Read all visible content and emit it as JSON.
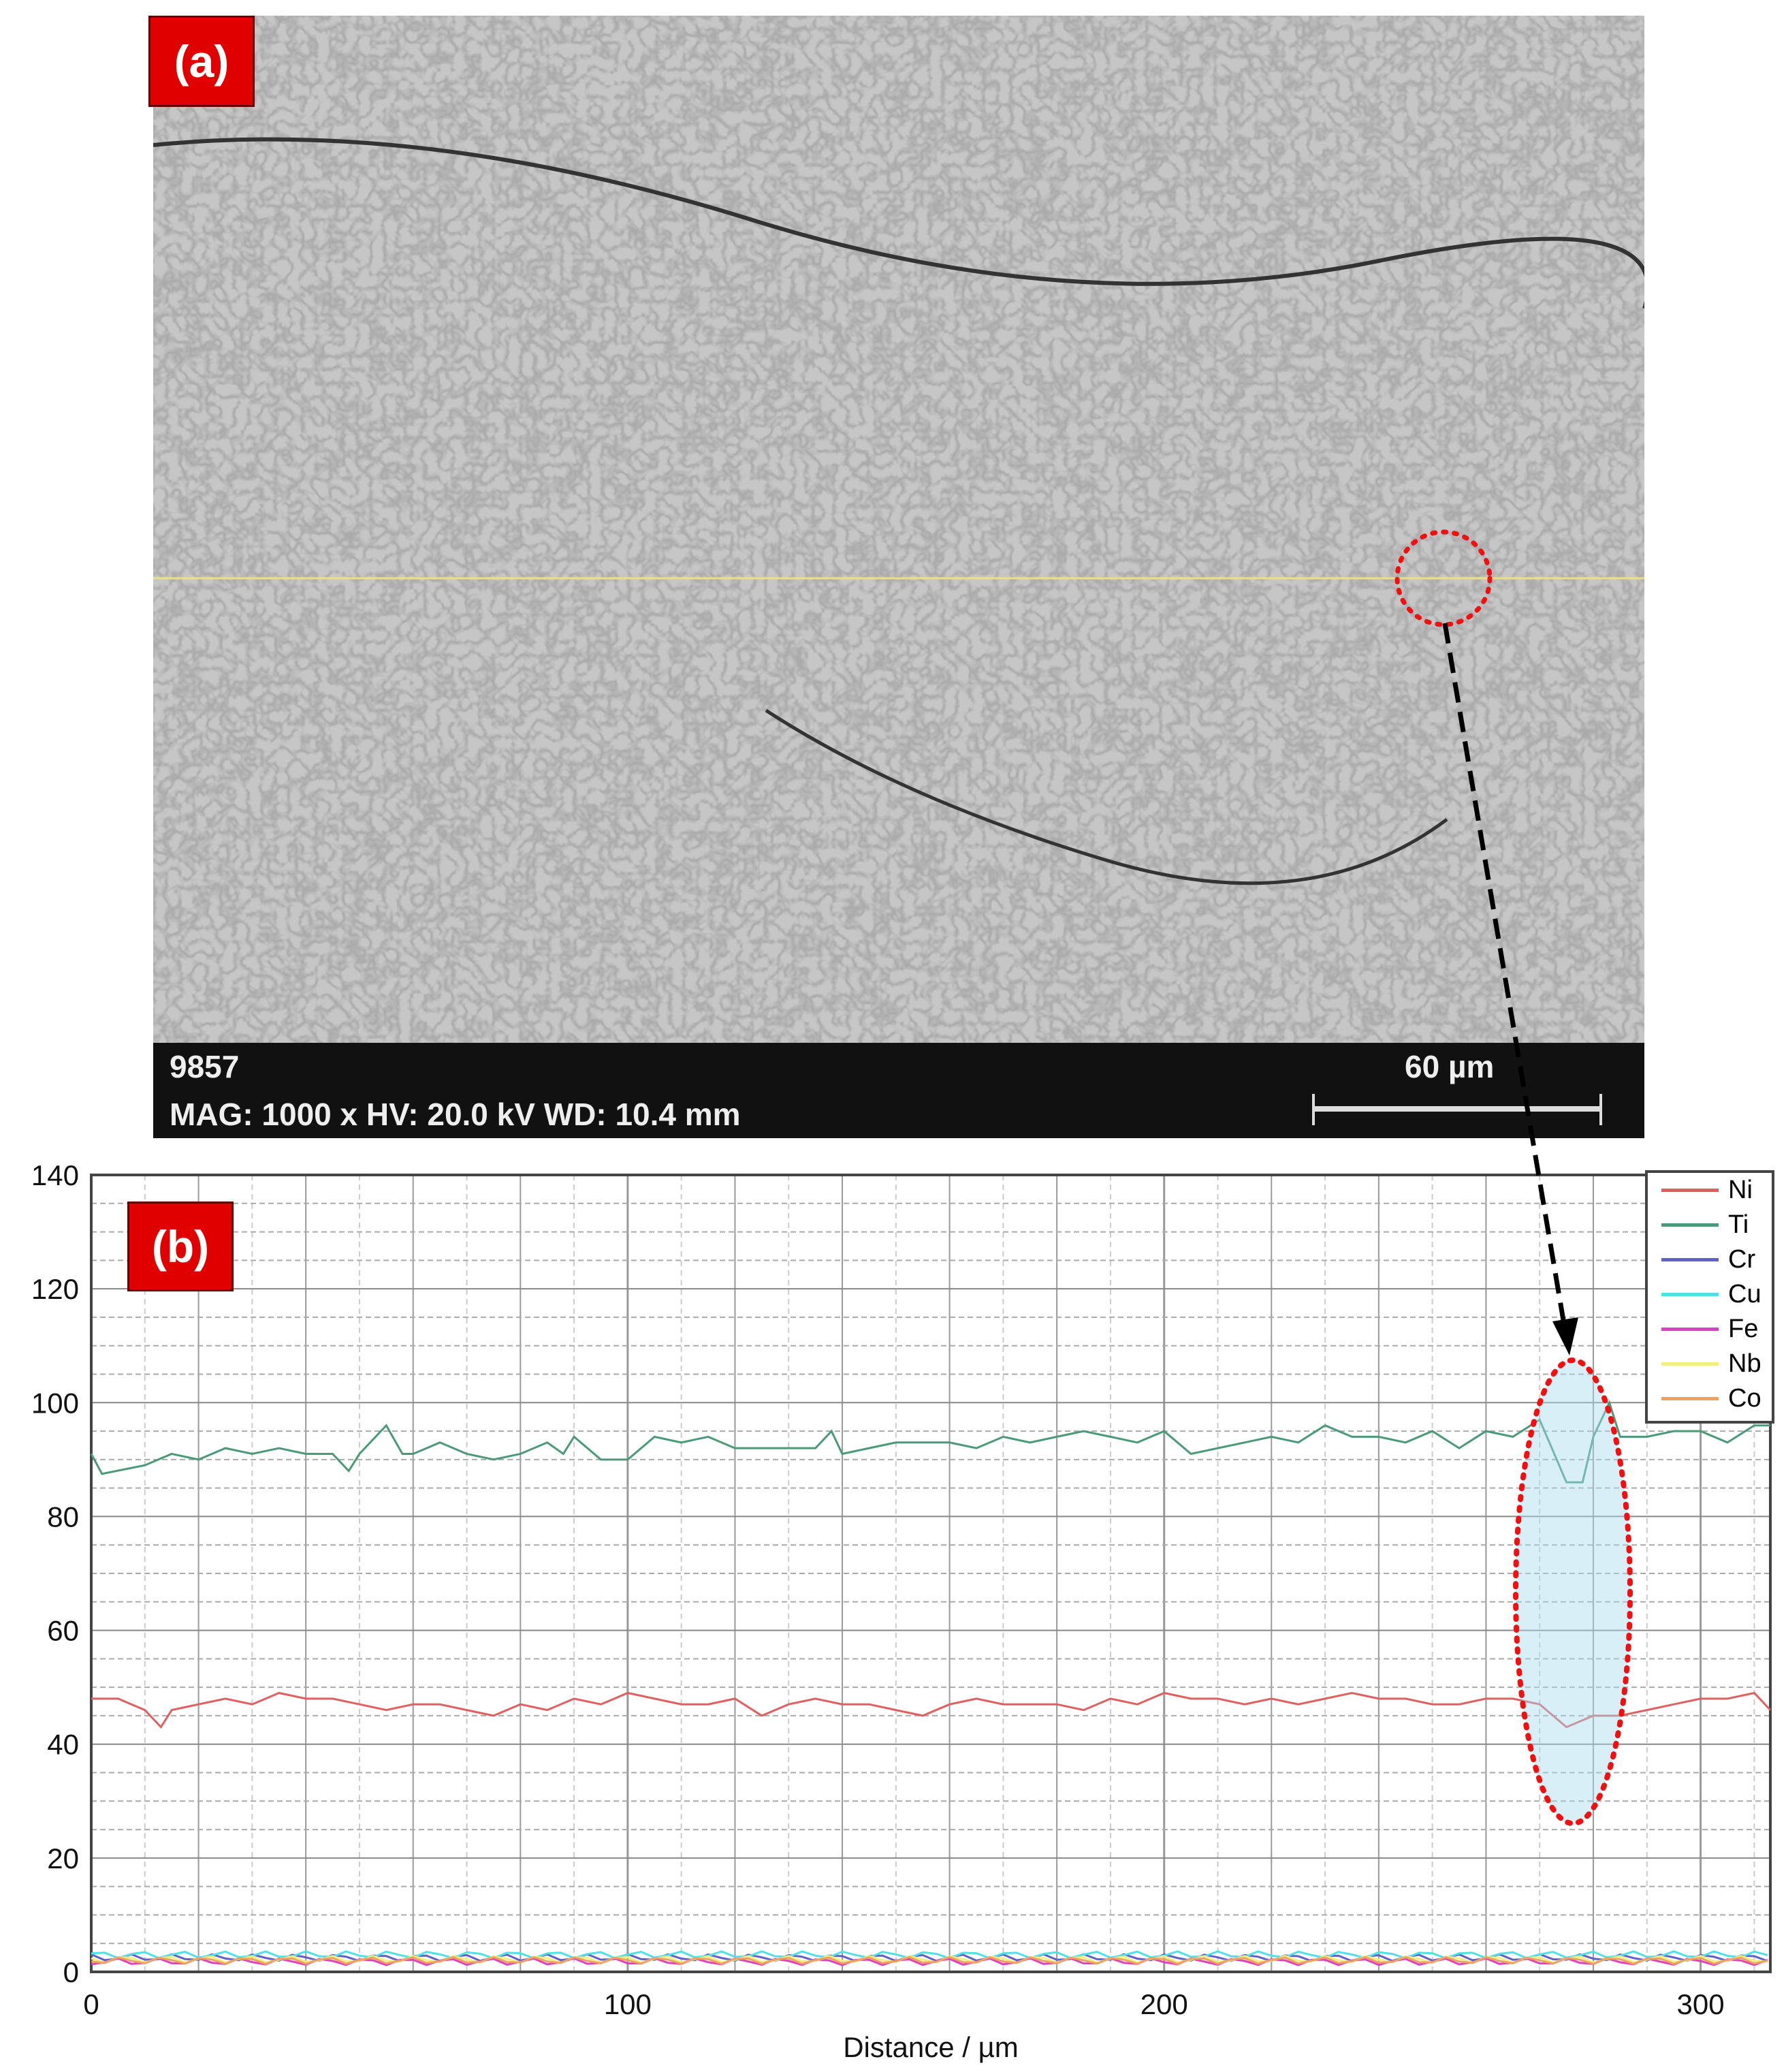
{
  "panel_a": {
    "label": "(a)",
    "image_id": "9857",
    "info": "MAG: 1000 x HV: 20.0 kV WD: 10.4 mm",
    "scale_label": "60 µm"
  },
  "panel_b": {
    "label": "(b)"
  },
  "chart_data": {
    "type": "line",
    "title": "",
    "xlabel": "Distance / µm",
    "ylabel": "",
    "xlim": [
      0,
      313
    ],
    "ylim": [
      0,
      140
    ],
    "xticks": [
      0,
      100,
      200,
      300
    ],
    "yticks": [
      0,
      20,
      40,
      60,
      80,
      100,
      120,
      140
    ],
    "grid": true,
    "legend_position": "top-right",
    "series": [
      {
        "name": "Ni",
        "color": "#e06060",
        "x": [
          0,
          5,
          10,
          13,
          15,
          20,
          25,
          30,
          35,
          40,
          45,
          50,
          55,
          60,
          65,
          70,
          75,
          80,
          85,
          90,
          95,
          100,
          105,
          110,
          115,
          120,
          125,
          130,
          135,
          140,
          145,
          150,
          155,
          160,
          165,
          170,
          175,
          180,
          185,
          190,
          195,
          200,
          205,
          210,
          215,
          220,
          225,
          230,
          235,
          240,
          245,
          250,
          255,
          260,
          265,
          270,
          275,
          280,
          285,
          290,
          295,
          300,
          305,
          310,
          313
        ],
        "y": [
          48,
          48,
          46,
          43,
          46,
          47,
          48,
          47,
          49,
          48,
          48,
          47,
          46,
          47,
          47,
          46,
          45,
          47,
          46,
          48,
          47,
          49,
          48,
          47,
          47,
          48,
          45,
          47,
          48,
          47,
          47,
          46,
          45,
          47,
          48,
          47,
          47,
          47,
          46,
          48,
          47,
          49,
          48,
          48,
          47,
          48,
          47,
          48,
          49,
          48,
          48,
          47,
          47,
          48,
          48,
          47,
          43,
          45,
          45,
          46,
          47,
          48,
          48,
          49,
          46
        ]
      },
      {
        "name": "Ti",
        "color": "#4a9a78",
        "x": [
          0,
          2,
          10,
          15,
          20,
          25,
          30,
          35,
          40,
          45,
          48,
          50,
          55,
          58,
          60,
          65,
          70,
          75,
          80,
          85,
          88,
          90,
          95,
          100,
          105,
          110,
          115,
          120,
          125,
          130,
          135,
          138,
          140,
          145,
          150,
          155,
          160,
          165,
          170,
          175,
          180,
          185,
          190,
          195,
          200,
          205,
          210,
          215,
          220,
          225,
          230,
          235,
          240,
          245,
          250,
          255,
          260,
          265,
          270,
          275,
          278,
          280,
          283,
          285,
          290,
          295,
          300,
          305,
          310,
          313
        ],
        "y": [
          91,
          87.5,
          89,
          91,
          90,
          92,
          91,
          92,
          91,
          91,
          88,
          91,
          96,
          91,
          91,
          93,
          91,
          90,
          91,
          93,
          91,
          94,
          90,
          90,
          94,
          93,
          94,
          92,
          92,
          92,
          92,
          95,
          91,
          92,
          93,
          93,
          93,
          92,
          94,
          93,
          94,
          95,
          94,
          93,
          95,
          91,
          92,
          93,
          94,
          93,
          96,
          94,
          94,
          93,
          95,
          92,
          95,
          94,
          97,
          86,
          86,
          94,
          100,
          94,
          94,
          95,
          95,
          93,
          96,
          96
        ]
      },
      {
        "name": "Cr",
        "color": "#6060c8",
        "x": [
          0,
          313
        ],
        "y": [
          2.5,
          2.5
        ]
      },
      {
        "name": "Cu",
        "color": "#50e0e8",
        "x": [
          0,
          313
        ],
        "y": [
          3,
          3
        ]
      },
      {
        "name": "Fe",
        "color": "#e040c0",
        "x": [
          0,
          313
        ],
        "y": [
          1.8,
          1.8
        ]
      },
      {
        "name": "Nb",
        "color": "#f0f080",
        "x": [
          0,
          313
        ],
        "y": [
          2.2,
          2.2
        ]
      },
      {
        "name": "Co",
        "color": "#f0a060",
        "x": [
          0,
          313
        ],
        "y": [
          2,
          2
        ]
      }
    ]
  }
}
